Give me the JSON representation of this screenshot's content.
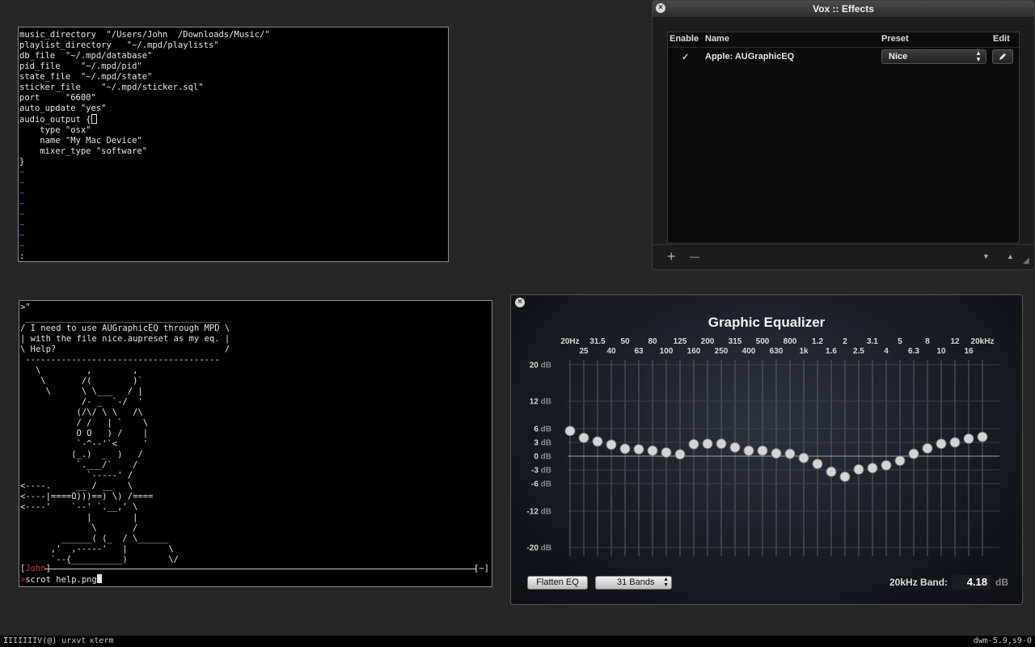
{
  "vim": {
    "lines": [
      "music_directory  \"/Users/John  /Downloads/Music/\"",
      "playlist_directory   \"~/.mpd/playlists\"",
      "db_file  \"~/.mpd/database\"",
      "pid_file    \"~/.mpd/pid\"",
      "state_file  \"~/.mpd/state\"",
      "sticker_file    \"~/.mpd/sticker.sql\"",
      "port     \"6600\"",
      "auto_update \"yes\"",
      "audio_output {",
      "    type \"osx\"",
      "    name \"My Mac Device\"",
      "    mixer_type \"software\"",
      "}"
    ],
    "tilde_count": 8,
    "tilde": "~",
    "cmdline": ":"
  },
  "cowsay": {
    "top_line": ">\"",
    "art": " ______________________________________\n/ I need to use AUGraphicEQ through MPD \\\n| with the file nice.aupreset as my eq. |\n\\ Help?                                 /\n --------------------------------------\n   \\         ,        ,\n    \\       /(        )`\n     \\      \\ \\___   / |\n            /- _  `-/  '\n           (/\\/ \\ \\   /\\\n           / /   | `    \\\n           O O   ) /    |\n           `-^--'`<     '\n          (_.)  _  )   /\n           `.___/`    /\n             `-----' /\n<----.     __ / __   \\\n<----|====O)))==) \\) /====\n<----'    `--' `.__,' \\\n             |        |\n              \\       /\n        ______( (_  / \\______\n      ,'  ,-----'   |        \\\n      `--{__________)        \\/",
    "status_user": "John",
    "status_bracket_left": "[",
    "status_bracket_right": "]",
    "status_dir": "[~]",
    "prompt_char": ">",
    "command": "scrot help.png"
  },
  "effects": {
    "title": "Vox :: Effects",
    "headers": {
      "enable": "Enable",
      "name": "Name",
      "preset": "Preset",
      "edit": "Edit"
    },
    "rows": [
      {
        "enabled": true,
        "check": "✓",
        "name": "Apple: AUGraphicEQ",
        "preset": "Nice",
        "edit_icon": "pencil-icon"
      }
    ],
    "add_icon": "+",
    "remove_icon": "—",
    "down_icon": "▼",
    "up_icon": "▲"
  },
  "equalizer": {
    "title": "Graphic Equalizer",
    "freq_labels_top": [
      "20Hz",
      "31.5",
      "50",
      "80",
      "125",
      "200",
      "315",
      "500",
      "800",
      "1.2",
      "2",
      "3.1",
      "5",
      "8",
      "12",
      "20kHz"
    ],
    "freq_labels_bottom": [
      "25",
      "40",
      "63",
      "100",
      "160",
      "250",
      "400",
      "630",
      "1k",
      "1.6",
      "2.5",
      "4",
      "6.3",
      "10",
      "16"
    ],
    "db_ticks": [
      20,
      12,
      6,
      3,
      0,
      -3,
      -6,
      -12,
      -20
    ],
    "db_tick_labels": [
      "20 dB",
      "12 dB",
      "6 dB",
      "3 dB",
      "0 dB",
      "-3 dB",
      "-6 dB",
      "-12 dB",
      "-20 dB"
    ],
    "band_gains_db": [
      5.5,
      4.0,
      3.2,
      2.5,
      1.6,
      1.5,
      1.2,
      0.8,
      0.4,
      2.6,
      2.7,
      2.7,
      1.9,
      1.2,
      1.2,
      0.6,
      0.5,
      -0.4,
      -1.7,
      -3.4,
      -4.5,
      -2.9,
      -2.6,
      -2.0,
      -1.0,
      0.5,
      1.7,
      2.7,
      3.0,
      3.8,
      4.2
    ],
    "flatten_label": "Flatten EQ",
    "bands_select": "31 Bands",
    "band_label": "20kHz Band:",
    "band_value": "4.18",
    "band_unit": "dB"
  },
  "dwm": {
    "tags": [
      "I",
      "II",
      "III",
      "IV",
      "(@)"
    ],
    "windows": [
      "urxvt",
      "xterm"
    ],
    "status": "dwm-5.9,s9-0"
  }
}
